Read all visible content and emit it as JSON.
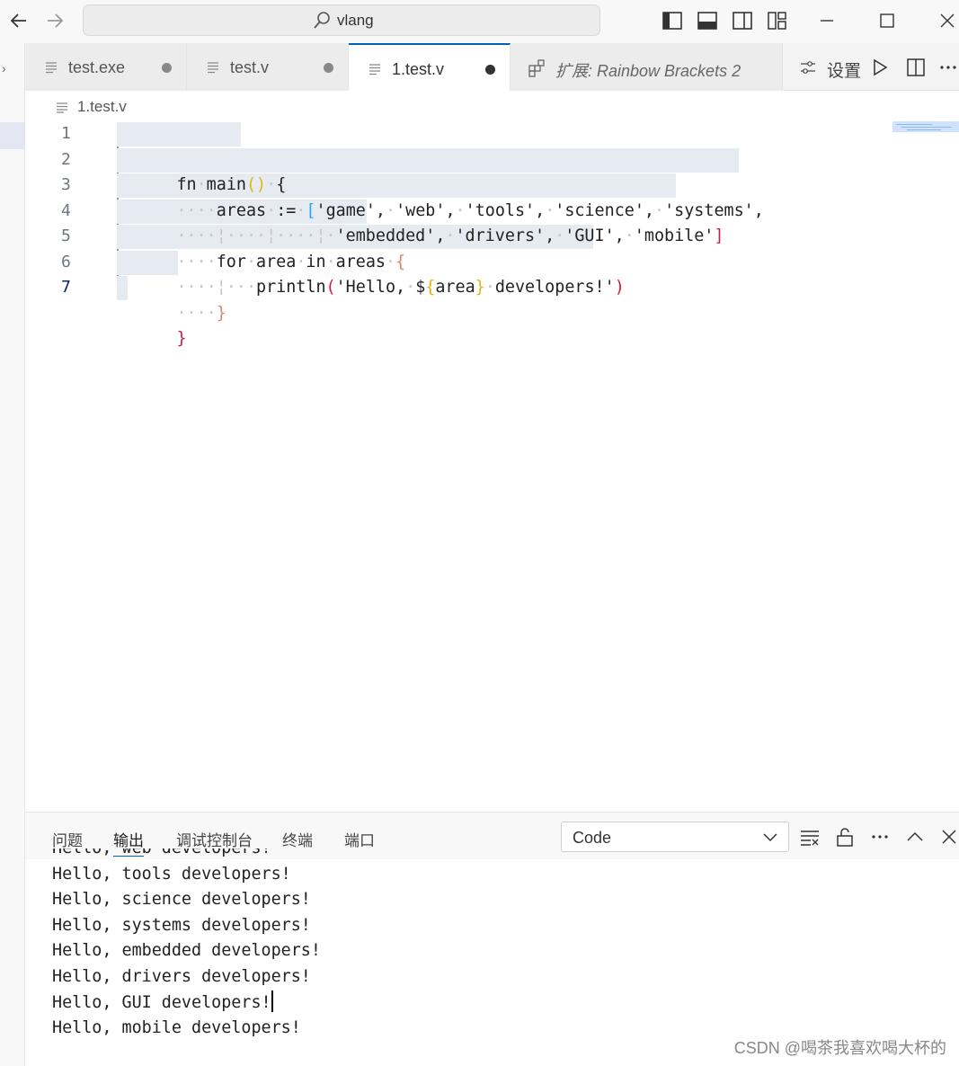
{
  "titlebar": {
    "search_text": "vlang",
    "icons": [
      "arrow-left-icon",
      "arrow-right-icon",
      "search-icon",
      "toggle-primary-sidebar-icon",
      "toggle-panel-icon",
      "toggle-secondary-sidebar-icon",
      "customize-layout-icon",
      "minimize-icon",
      "maximize-icon",
      "close-icon"
    ]
  },
  "tabs": [
    {
      "label": "test.exe",
      "dirty": true
    },
    {
      "label": "test.v",
      "dirty": true
    },
    {
      "label": "1.test.v",
      "dirty": true,
      "active": true
    },
    {
      "label": "扩展: Rainbow Brackets 2",
      "extension": true
    }
  ],
  "tab_actions": {
    "settings_label": "设置",
    "icons": [
      "settings-sliders-icon",
      "run-icon",
      "split-editor-icon",
      "more-actions-icon"
    ]
  },
  "breadcrumb": {
    "file": "1.test.v"
  },
  "editor": {
    "line_numbers": [
      "1",
      "2",
      "3",
      "4",
      "5",
      "6",
      "7"
    ],
    "current_line": "7"
  },
  "panel": {
    "tabs": [
      "问题",
      "输出",
      "调试控制台",
      "终端",
      "端口"
    ],
    "active_tab": "输出",
    "output_channel": "Code",
    "output_lines": [
      "Hello, web developers!",
      "Hello, tools developers!",
      "Hello, science developers!",
      "Hello, systems developers!",
      "Hello, embedded developers!",
      "Hello, drivers developers!",
      "Hello, GUI developers!",
      "Hello, mobile developers!"
    ]
  },
  "watermark": "CSDN @喝茶我喜欢喝大杯的",
  "colors": {
    "accent": "#005fb8",
    "selection": "#e5ebf1",
    "bracket_level1": "#e2b614",
    "bracket_level2": "#d11a3d",
    "bracket_level3": "#2aa9f0",
    "bracket_level4": "#d8896b"
  }
}
